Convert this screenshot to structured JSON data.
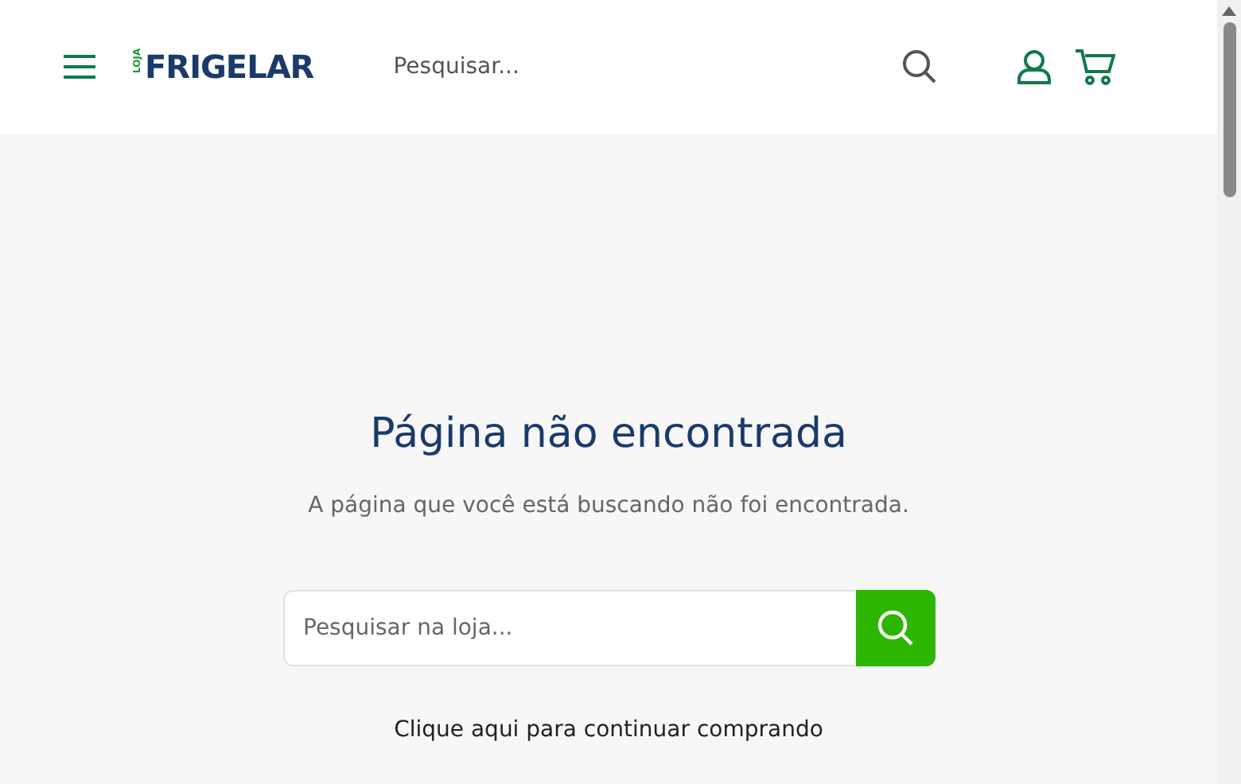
{
  "header": {
    "logo": {
      "small": "LOJA",
      "main": "FRIGELAR"
    },
    "search": {
      "placeholder": "Pesquisar..."
    }
  },
  "main": {
    "title": "Página não encontrada",
    "message": "A página que você está buscando não foi encontrada.",
    "search": {
      "placeholder": "Pesquisar na loja..."
    },
    "link": "Clique aqui para continuar comprando"
  }
}
